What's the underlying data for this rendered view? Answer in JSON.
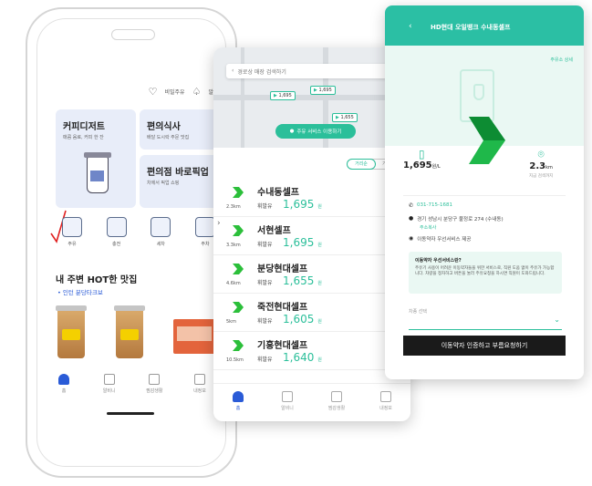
{
  "colors": {
    "accent": "#2bbf9a",
    "primary": "#2a5bd7",
    "cta": "#1a1a1a",
    "card": "#e8edf9"
  },
  "screen1": {
    "top_links": [
      {
        "icon": "heart-icon",
        "label": "비밀주유"
      },
      {
        "icon": "bell-icon",
        "label": "알"
      }
    ],
    "cards": [
      {
        "title": "커피디저트",
        "sub": "매콤 음료, 커피 한 잔"
      },
      {
        "title": "편의식사",
        "sub": "배달 도시락 주문 맛집"
      },
      {
        "title": "편의점 바로픽업",
        "sub": "차에서 픽업 쇼핑"
      }
    ],
    "categories": [
      "주유",
      "충전",
      "세차",
      "주차"
    ],
    "hot_title": "내 주변 HOT한 맛집",
    "hot_sub": "• 인턴 분당타크보",
    "nav": [
      "홈",
      "알비니",
      "찜감생활",
      "내정보"
    ]
  },
  "screen2": {
    "search_placeholder": "경로상 매장 검색하기",
    "pins": [
      "1,695",
      "1,695",
      "1,655"
    ],
    "map_button": "주유 서비스 이용하기",
    "toggle": [
      "거리순",
      "가격순"
    ],
    "stations": [
      {
        "name": "수내동셀프",
        "dist": "2.3km",
        "fuel": "휘발유",
        "price": "1,695",
        "unit": "원"
      },
      {
        "name": "서현셀프",
        "dist": "3.3km",
        "fuel": "휘발유",
        "price": "1,695",
        "unit": "원"
      },
      {
        "name": "분당현대셀프",
        "dist": "4.6km",
        "fuel": "휘발유",
        "price": "1,655",
        "unit": "원"
      },
      {
        "name": "죽전현대셀프",
        "dist": "5km",
        "fuel": "휘발유",
        "price": "1,605",
        "unit": "원"
      },
      {
        "name": "기흥현대셀프",
        "dist": "10.5km",
        "fuel": "휘발유",
        "price": "1,640",
        "unit": "원"
      }
    ],
    "nav": [
      "홈",
      "알비니",
      "찜감생활",
      "내정보"
    ]
  },
  "screen3": {
    "title": "HD현대 오일뱅크 수내동셀프",
    "more": "주유소 상세",
    "price_value": "1,695",
    "price_unit": "원/L",
    "distance_value": "2.3",
    "distance_unit": "km",
    "distance_caption": "지금 검색까지",
    "phone": "031-715-1681",
    "address": "경기 성남시 분당구 불정로 274 (수내동)",
    "copy_label": "주소복사",
    "service": "이동약자 우선서비스 제공",
    "notice_q": "이동약자 우선서비스란?",
    "notice_a": "주유기 사용이 어려운 이동약자들을 위한 서비스로, 직원 도움 없이 주유가 가능합니다. 차량을 정차하고 버튼을 눌러 주유요청을 하시면 직원이 도와드립니다.",
    "select_label": "차종 선택",
    "cta": "이동약자 인증하고 부름요청하기"
  }
}
